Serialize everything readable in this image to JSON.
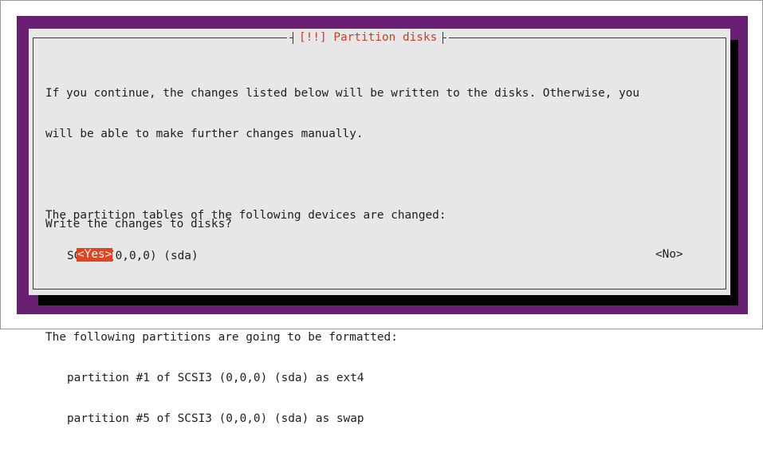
{
  "dialog": {
    "title": "[!!] Partition disks",
    "lines": [
      "If you continue, the changes listed below will be written to the disks. Otherwise, you",
      "will be able to make further changes manually.",
      "",
      "The partition tables of the following devices are changed:",
      "SCSI3 (0,0,0) (sda)",
      "",
      "The following partitions are going to be formatted:",
      "partition #1 of SCSI3 (0,0,0) (sda) as ext4",
      "partition #5 of SCSI3 (0,0,0) (sda) as swap"
    ],
    "question": "Write the changes to disks?",
    "yes_label": "<Yes>",
    "no_label": "<No>"
  },
  "colors": {
    "terminal_bg": "#6a1f72",
    "dialog_bg": "#e7e7e7",
    "title_color": "#c8402a",
    "selected_button_bg": "#e2421e"
  }
}
